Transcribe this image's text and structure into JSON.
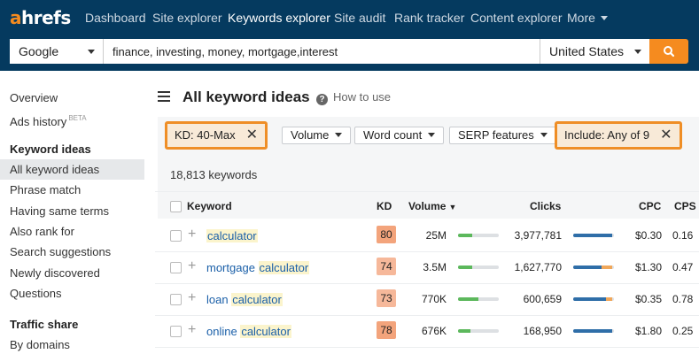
{
  "brand": {
    "logo_a": "a",
    "logo_rest": "hrefs",
    "accent": "#f58b1f",
    "nav_bg": "#053a5f"
  },
  "nav": {
    "items": [
      {
        "label": "Dashboard"
      },
      {
        "label": "Site explorer"
      },
      {
        "label": "Keywords explorer"
      },
      {
        "label": "Site audit"
      },
      {
        "label": "Rank tracker"
      },
      {
        "label": "Content explorer"
      },
      {
        "label": "More"
      }
    ],
    "active": "Keywords explorer"
  },
  "search": {
    "engine": "Google",
    "query": "finance, investing, money, mortgage,interest",
    "country": "United States",
    "search_icon": "search-icon"
  },
  "sidebar": {
    "overview": "Overview",
    "ads_history": "Ads history",
    "ads_history_badge": "BETA",
    "keyword_ideas_head": "Keyword ideas",
    "items": [
      {
        "label": "All keyword ideas"
      },
      {
        "label": "Phrase match"
      },
      {
        "label": "Having same terms"
      },
      {
        "label": "Also rank for"
      },
      {
        "label": "Search suggestions"
      },
      {
        "label": "Newly discovered"
      },
      {
        "label": "Questions"
      }
    ],
    "traffic_head": "Traffic share",
    "by_domains": "By domains"
  },
  "page": {
    "title": "All keyword ideas",
    "help": "How to use"
  },
  "filters": {
    "kd": "KD: 40-Max",
    "volume": "Volume",
    "word_count": "Word count",
    "serp": "SERP features",
    "include": "Include: Any of 9",
    "highlight_color": "#ef8e26"
  },
  "results": {
    "count": "18,813 keywords"
  },
  "table": {
    "headers": {
      "keyword": "Keyword",
      "kd": "KD",
      "volume": "Volume",
      "clicks": "Clicks",
      "cpc": "CPC",
      "cps": "CPS"
    },
    "rows": [
      {
        "prefix": "",
        "match": "calculator",
        "kd": "80",
        "kd_color": "#f3a47c",
        "volume": "25M",
        "volume_fill": 0.35,
        "clicks": "3,977,781",
        "clicks_fill": 0.95,
        "clicks_paid": 0.0,
        "cpc": "$0.30",
        "cps": "0.16"
      },
      {
        "prefix": "mortgage ",
        "match": "calculator",
        "kd": "74",
        "kd_color": "#f6b89a",
        "volume": "3.5M",
        "volume_fill": 0.35,
        "clicks": "1,627,770",
        "clicks_fill": 0.7,
        "clicks_paid": 0.25,
        "cpc": "$1.30",
        "cps": "0.47"
      },
      {
        "prefix": "loan ",
        "match": "calculator",
        "kd": "73",
        "kd_color": "#f6b89a",
        "volume": "770K",
        "volume_fill": 0.5,
        "clicks": "600,659",
        "clicks_fill": 0.8,
        "clicks_paid": 0.15,
        "cpc": "$0.35",
        "cps": "0.78"
      },
      {
        "prefix": "online ",
        "match": "calculator",
        "kd": "78",
        "kd_color": "#f3a47c",
        "volume": "676K",
        "volume_fill": 0.3,
        "clicks": "168,950",
        "clicks_fill": 0.95,
        "clicks_paid": 0.0,
        "cpc": "$1.80",
        "cps": "0.25"
      }
    ],
    "bar_colors": {
      "volume": "#5cb85c",
      "clicks": "#2f6ea8",
      "paid": "#f0a75a",
      "track": "#dde0e3"
    }
  }
}
